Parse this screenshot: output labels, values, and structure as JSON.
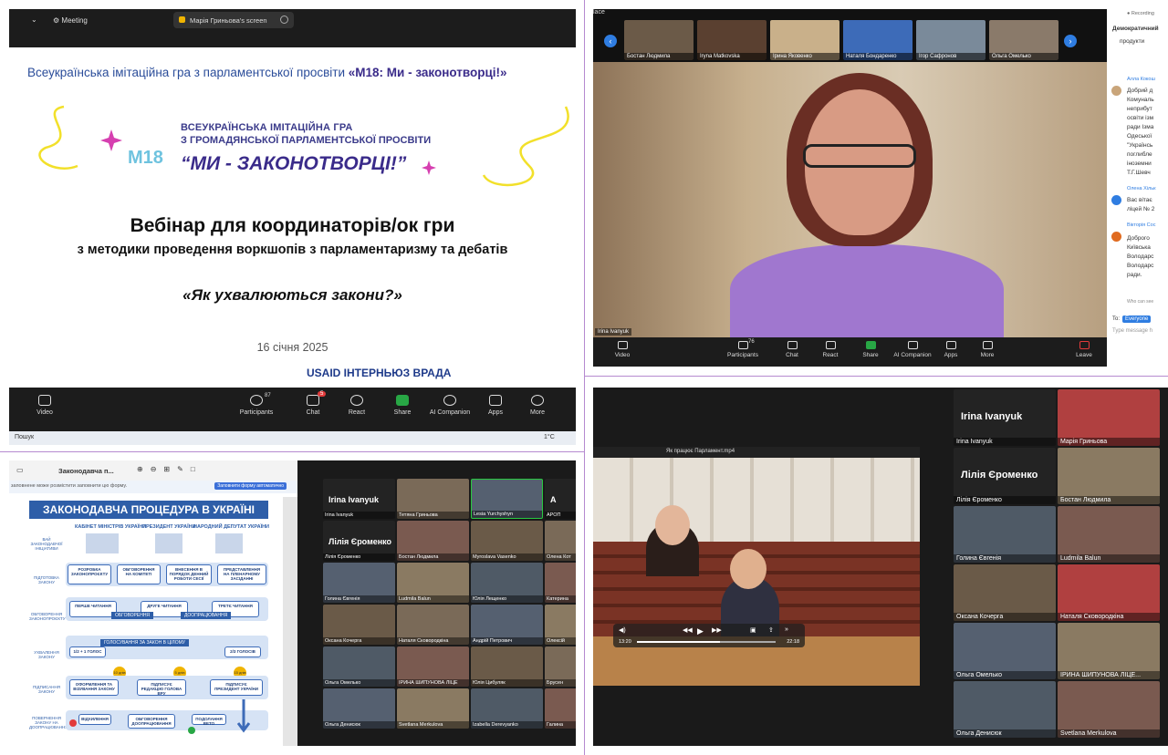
{
  "q1": {
    "top": {
      "meeting_label": "Meeting",
      "share_label": "Марія Гриньова's screen"
    },
    "slide": {
      "header_prefix": "Всеукраїнська імітаційна гра з парламентської просвіти ",
      "header_bold": "«М18: Ми - законотворці!»",
      "logo_line1": "ВСЕУКРАЇНСЬКА ІМІТАЦІЙНА ГРА",
      "logo_line2": "З ГРОМАДЯНСЬКОЇ ПАРЛАМЕНТСЬКОЇ ПРОСВІТИ",
      "logo_line3": "“МИ - ЗАКОНОТВОРЦІ!”",
      "logo_m18": "М18",
      "title": "Вебінар для координаторів/ок гри",
      "subtitle": "з методики проведення воркшопів з парламентаризму та дебатів",
      "quote": "«Як ухвалюються закони?»",
      "date": "16 січня 2025",
      "footer": "USAID  ІНТЕРНЬЮЗ  ВРАДА"
    },
    "controls": {
      "video": "Video",
      "participants": "Participants",
      "participants_count": "87",
      "chat": "Chat",
      "chat_badge": "5",
      "react": "React",
      "share": "Share",
      "ai": "AI Companion",
      "apps": "Apps",
      "more": "More"
    },
    "taskbar": {
      "search": "Пошук",
      "temp": "1°C"
    }
  },
  "q2": {
    "place": "lace",
    "thumbs": [
      "Бостан Людмила",
      "Iryna Matkovska",
      "Ірина Яковенко",
      "Наталя Бондаренко",
      "Ігор Сафронов",
      "Ольга Омелько"
    ],
    "speaker_name": "Irina Ivanyuk",
    "controls": {
      "video": "Video",
      "participants": "Participants",
      "participants_count": "76",
      "chat": "Chat",
      "react": "React",
      "share": "Share",
      "ai": "AI Companion",
      "apps": "Apps",
      "more": "More",
      "leave": "Leave"
    },
    "chat": {
      "recording": "Recording",
      "header": "Демократичний",
      "line1": "продукти",
      "sender1": "Алла Кокош",
      "msg1": [
        "Добрий д",
        "Комуналь",
        "неприбут",
        "освіти ізм",
        "ради Ізма",
        "Одеської",
        "\"Українсь",
        "поглибле",
        "іноземни",
        "Т.Г.Шевч"
      ],
      "sender2": "Олена Хільк",
      "msg2": [
        "Вас вітає",
        "ліцей № 2"
      ],
      "sender3": "Вікторія Сос",
      "msg3": [
        "Доброго",
        "Київська",
        "Володарс",
        "Володарс",
        "ради."
      ],
      "who": "Who can see",
      "to_label": "To:",
      "to_value": "Everyone",
      "input_placeholder": "Type message h"
    }
  },
  "q3": {
    "doc_title": "Законодавча п...",
    "doc_note": "заповнене може розмістити заповнити цю форму.",
    "doc_note_btn": "Заповнити форму автоматично",
    "proc_title": "ЗАКОНОДАВЧА ПРОЦЕДУРА В УКРАЇНІ",
    "cols": [
      "КАБІНЕТ МІНІСТРІВ УКРАЇНИ",
      "ПРЕЗИДЕНТ УКРАЇНИ",
      "НАРОДНИЙ ДЕПУТАТ УКРАЇНИ"
    ],
    "sides": [
      "ВАЙ ЗАКОНОДАВЧОЇ ІНІЦІАТИВИ",
      "ПІДГОТОВКА ЗАКОНУ",
      "ОБГОВОРЕННЯ ЗАКОНОПРОЄКТУ",
      "УХВАЛЕННЯ ЗАКОНУ",
      "ПІДПИСАННЯ ЗАКОНУ",
      "ПОВЕРНЕННЯ ЗАКОНУ НА ДООПРАЦЮВАННЯ"
    ],
    "row1": [
      "РОЗРОБКА ЗАКОНОПРОЄКТУ",
      "ОБГОВОРЕННЯ НА КОМІТЕТІ",
      "ВНЕСЕННЯ В ПОРЯДОК ДЕННИЙ РОБОТИ СЕСІЇ",
      "ПРЕДСТАВЛЕННЯ НА ПЛЕНАРНОМУ ЗАСІДАННІ"
    ],
    "row2": [
      "ПЕРШЕ ЧИТАННЯ",
      "ДРУГЕ ЧИТАННЯ",
      "ТРЕТЄ ЧИТАННЯ"
    ],
    "row2_lbls": [
      "ОБГОВОРЕННЯ",
      "ДООПРАЦЮВАННЯ"
    ],
    "row3_lbl": "ГОЛОСУВАННЯ ЗА ЗАКОН В ЦІЛОМУ",
    "row3": [
      "1/2 + 1 ГОЛОС",
      "2/3 ГОЛОСІВ"
    ],
    "row4": [
      "ОФОРМЛЕННЯ ТА ВІЗУВАННЯ ЗАКОНУ",
      "ПІДПИСУЄ РЕДАКЦІЮ ГОЛОВА ВРУ",
      "ПІДПИСУЄ ПРЕЗИДЕНТ УКРАЇНИ"
    ],
    "row5": [
      "ВІДХИЛЕННЯ",
      "ОБГОВОРЕННЯ ДООПРАЦЮВАННЯ",
      "ПОДОЛАННЯ ВЕТО"
    ],
    "days": [
      "10 днів",
      "5 днів",
      "15 днів"
    ],
    "tiles": [
      {
        "name": "Irina Ivanyuk",
        "big": "Irina Ivanyuk",
        "dark": true
      },
      {
        "name": "Тетяна Гриньова",
        "big": "",
        "dark": false
      },
      {
        "name": "Lesia Yurchyshyn",
        "big": "",
        "dark": false,
        "active": true
      },
      {
        "name": "АРОП",
        "big": "А",
        "dark": true
      },
      {
        "name": "Лілія Єроменко",
        "big": "Лілія Єроменко",
        "dark": true
      },
      {
        "name": "Бостан Людмила",
        "big": "",
        "dark": false
      },
      {
        "name": "Myroslava Vasenko",
        "big": "",
        "dark": false
      },
      {
        "name": "Олена Кот",
        "big": "",
        "dark": false
      },
      {
        "name": "Голина Євгенія",
        "big": "",
        "dark": false
      },
      {
        "name": "Ludmila Balun",
        "big": "",
        "dark": false
      },
      {
        "name": "Юлія Лещенко",
        "big": "",
        "dark": false
      },
      {
        "name": "Катерина",
        "big": "",
        "dark": false
      },
      {
        "name": "Оксана Кочерга",
        "big": "",
        "dark": false
      },
      {
        "name": "Наталя Сковородкіна",
        "big": "",
        "dark": false
      },
      {
        "name": "Андрій Петрович",
        "big": "",
        "dark": false
      },
      {
        "name": "Олексій",
        "big": "",
        "dark": false
      },
      {
        "name": "Ольга Омелько",
        "big": "",
        "dark": false
      },
      {
        "name": "ІРИНА ШИПУНОВА ЛІЦЕ",
        "big": "",
        "dark": false
      },
      {
        "name": "Юлія Цибуляк",
        "big": "",
        "dark": false
      },
      {
        "name": "Брусен",
        "big": "",
        "dark": false
      },
      {
        "name": "Ольга Денисюк",
        "big": "",
        "dark": false
      },
      {
        "name": "Svetlana Merkulova",
        "big": "",
        "dark": false
      },
      {
        "name": "Izabella Derevyanko",
        "big": "",
        "dark": false
      },
      {
        "name": "Галина",
        "big": "",
        "dark": false
      }
    ]
  },
  "q4": {
    "video_title": "Як працює Парламент.mp4",
    "time_left": "13:20",
    "time_right": "22:18",
    "progress": 0.6,
    "tiles": [
      {
        "name": "Irina Ivanyuk",
        "big": "Irina Ivanyuk",
        "dark": true
      },
      {
        "name": "Марія Гриньова",
        "big": "",
        "dark": false
      },
      {
        "name": "Лілія Єроменко",
        "big": "Лілія Єроменко",
        "dark": true
      },
      {
        "name": "Бостан Людмила",
        "big": "",
        "dark": false
      },
      {
        "name": "Голина Євгенія",
        "big": "",
        "dark": false
      },
      {
        "name": "Ludmila Balun",
        "big": "",
        "dark": false
      },
      {
        "name": "Оксана Кочерга",
        "big": "",
        "dark": false
      },
      {
        "name": "Наталя Сковородкіна",
        "big": "",
        "dark": false
      },
      {
        "name": "Ольга Омелько",
        "big": "",
        "dark": false
      },
      {
        "name": "ІРИНА ШИПУНОВА ЛІЦЕ...",
        "big": "",
        "dark": false
      },
      {
        "name": "Ольга Денисюк",
        "big": "",
        "dark": false
      },
      {
        "name": "Svetlana Merkulova",
        "big": "",
        "dark": false
      }
    ]
  }
}
